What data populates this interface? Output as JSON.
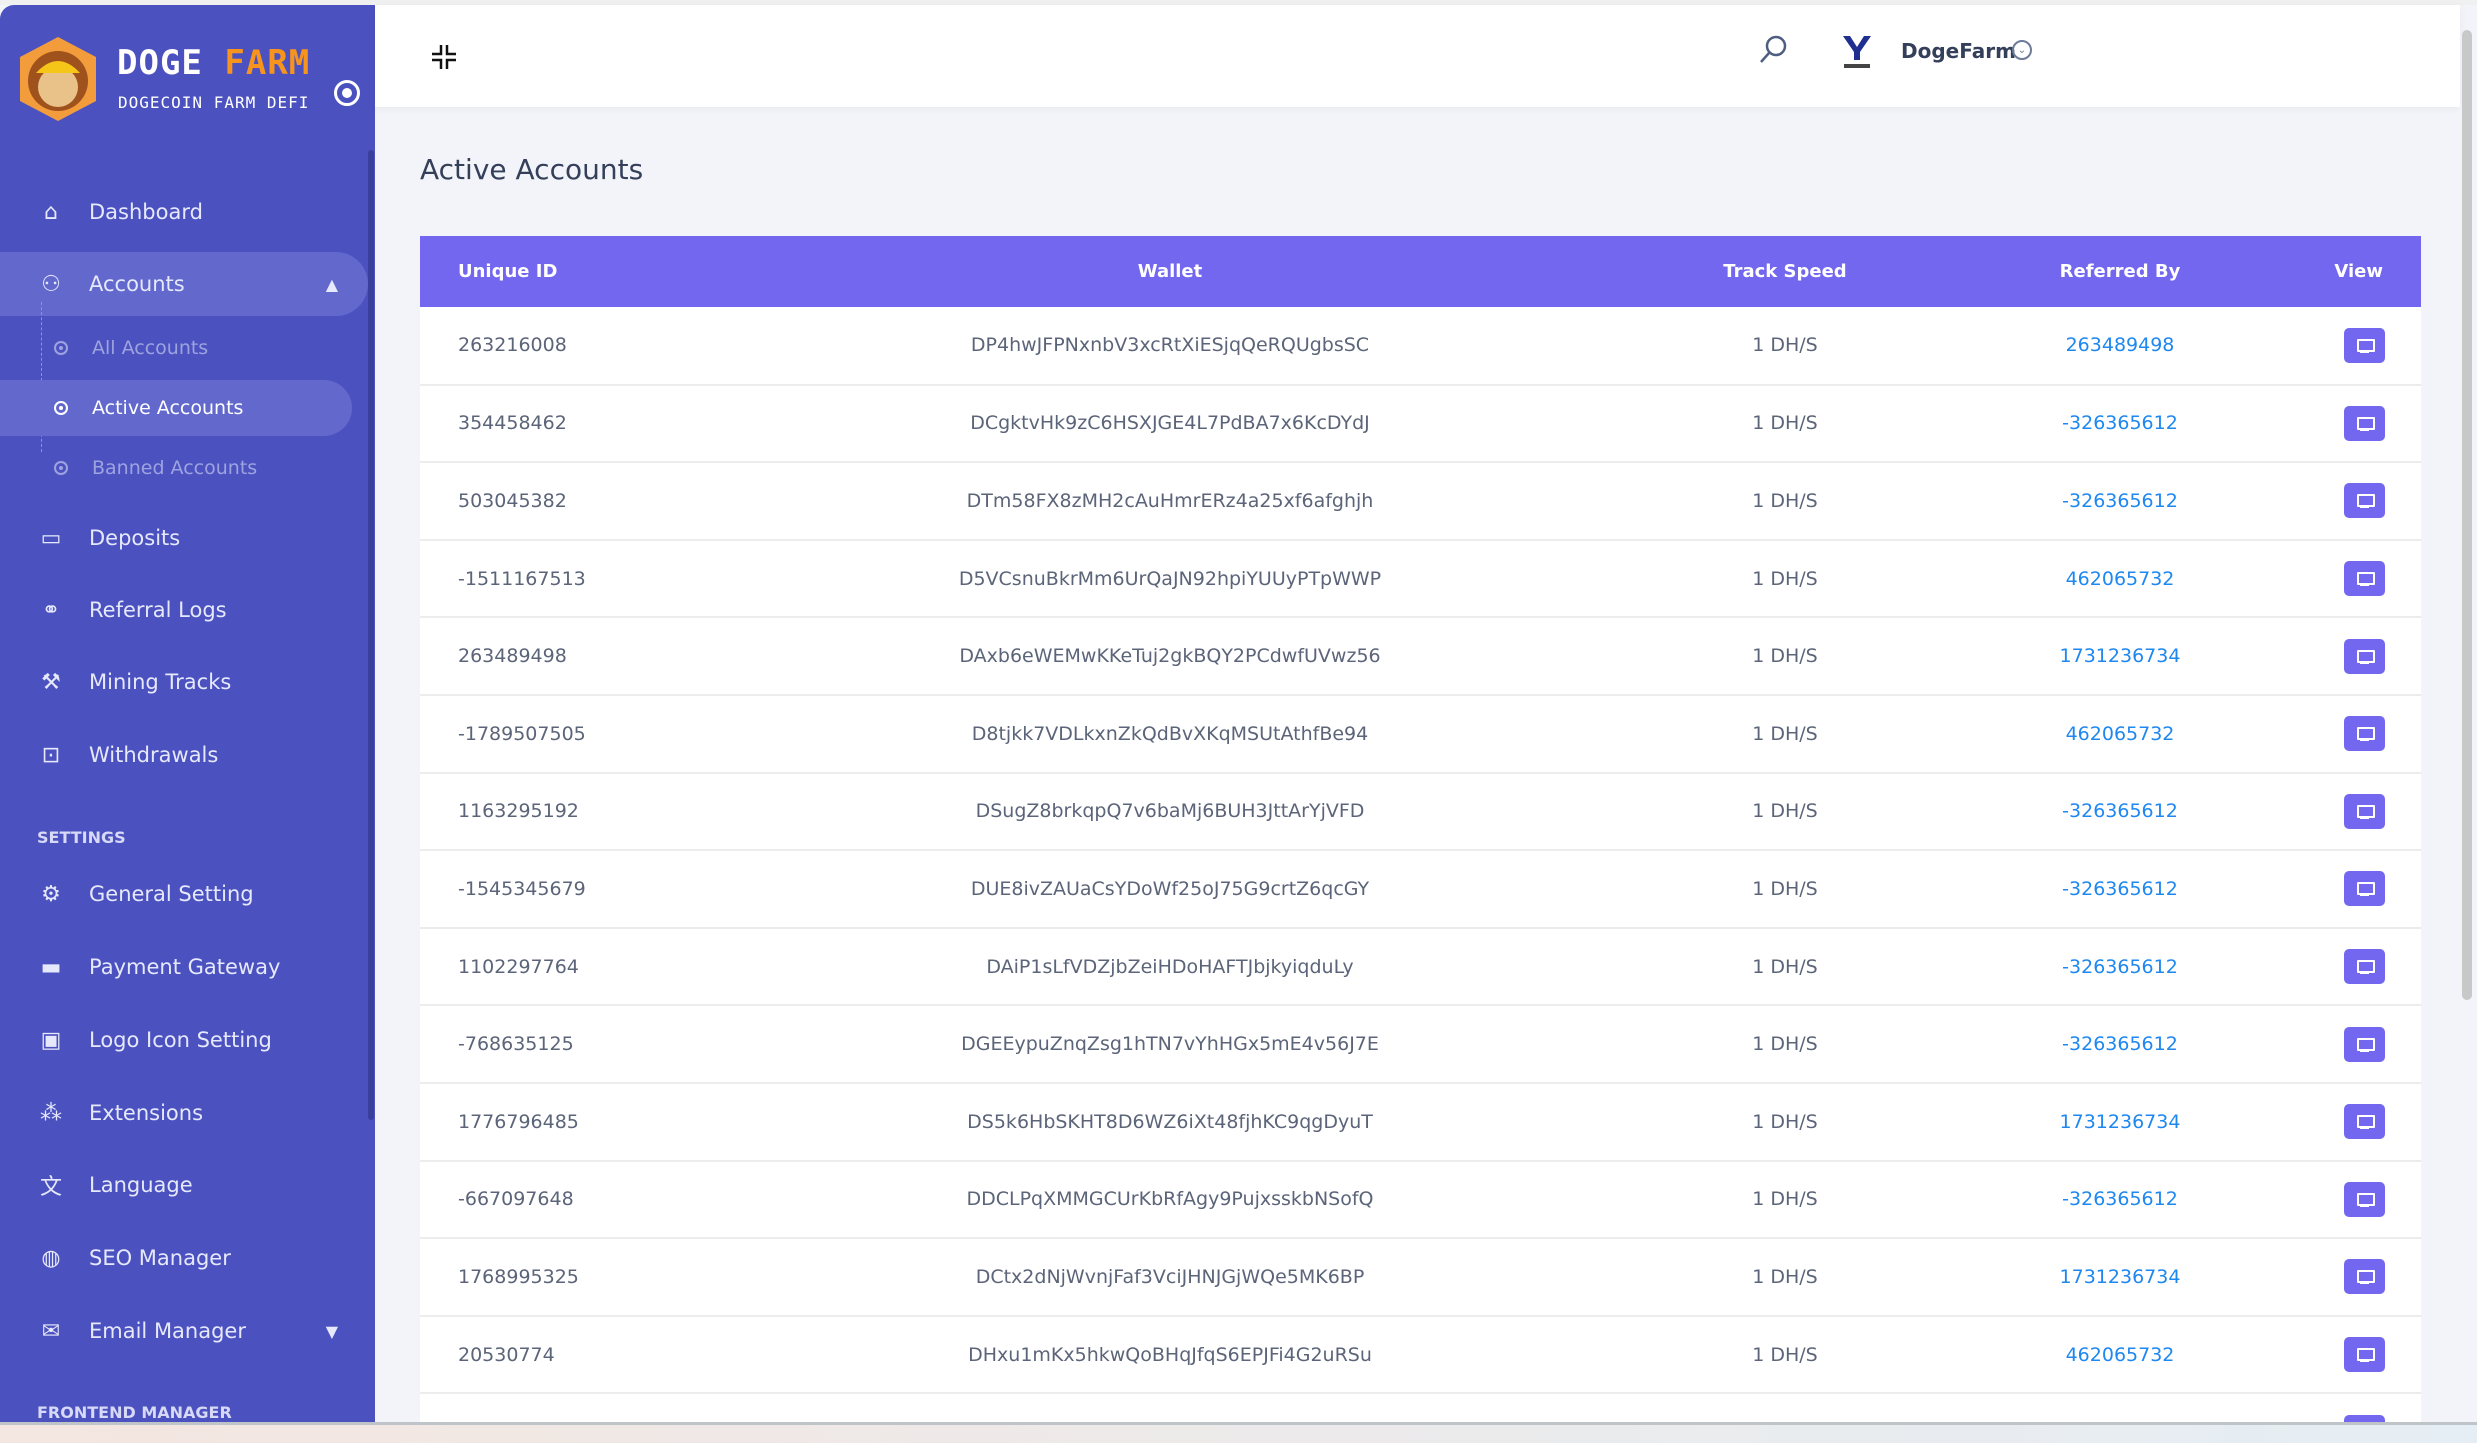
{
  "brand": {
    "name_part1": "DOGE",
    "name_part2": "FARM",
    "tagline": "DOGECOIN FARM DEFI"
  },
  "sidebar": {
    "items": [
      {
        "label": "Dashboard",
        "icon": "home-icon"
      },
      {
        "label": "Accounts",
        "icon": "users-icon"
      },
      {
        "label": "Deposits",
        "icon": "wallet-icon"
      },
      {
        "label": "Referral Logs",
        "icon": "referral-icon"
      },
      {
        "label": "Mining Tracks",
        "icon": "hammer-icon"
      },
      {
        "label": "Withdrawals",
        "icon": "money-icon"
      }
    ],
    "accounts_sub": [
      {
        "label": "All Accounts"
      },
      {
        "label": "Active Accounts"
      },
      {
        "label": "Banned Accounts"
      }
    ],
    "settings_heading": "SETTINGS",
    "settings_items": [
      {
        "label": "General Setting",
        "icon": "gear-icon"
      },
      {
        "label": "Payment Gateway",
        "icon": "credit-card-icon"
      },
      {
        "label": "Logo Icon Setting",
        "icon": "image-icon"
      },
      {
        "label": "Extensions",
        "icon": "puzzle-icon"
      },
      {
        "label": "Language",
        "icon": "language-icon"
      },
      {
        "label": "SEO Manager",
        "icon": "globe-icon"
      },
      {
        "label": "Email Manager",
        "icon": "envelope-icon"
      }
    ],
    "frontend_heading": "FRONTEND MANAGER"
  },
  "header": {
    "username": "DogeFarm"
  },
  "page": {
    "title": "Active Accounts"
  },
  "table": {
    "headers": [
      "Unique ID",
      "Wallet",
      "Track Speed",
      "Referred By",
      "View"
    ],
    "rows": [
      [
        "263216008",
        "DP4hwJFPNxnbV3xcRtXiESjqQeRQUgbsSC",
        "1 DH/S",
        "263489498"
      ],
      [
        "354458462",
        "DCgktvHk9zC6HSXJGE4L7PdBA7x6KcDYdJ",
        "1 DH/S",
        "-326365612"
      ],
      [
        "503045382",
        "DTm58FX8zMH2cAuHmrERz4a25xf6afghjh",
        "1 DH/S",
        "-326365612"
      ],
      [
        "-1511167513",
        "D5VCsnuBkrMm6UrQaJN92hpiYUUyPTpWWP",
        "1 DH/S",
        "462065732"
      ],
      [
        "263489498",
        "DAxb6eWEMwKKeTuj2gkBQY2PCdwfUVwz56",
        "1 DH/S",
        "1731236734"
      ],
      [
        "-1789507505",
        "D8tjkk7VDLkxnZkQdBvXKqMSUtAthfBe94",
        "1 DH/S",
        "462065732"
      ],
      [
        "1163295192",
        "DSugZ8brkqpQ7v6baMj6BUH3JttArYjVFD",
        "1 DH/S",
        "-326365612"
      ],
      [
        "-1545345679",
        "DUE8ivZAUaCsYDoWf25oJ75G9crtZ6qcGY",
        "1 DH/S",
        "-326365612"
      ],
      [
        "1102297764",
        "DAiP1sLfVDZjbZeiHDoHAFTJbjkyiqduLy",
        "1 DH/S",
        "-326365612"
      ],
      [
        "-768635125",
        "DGEEypuZnqZsg1hTN7vYhHGx5mE4v56J7E",
        "1 DH/S",
        "-326365612"
      ],
      [
        "1776796485",
        "DS5k6HbSKHT8D6WZ6iXt48fjhKC9qgDyuT",
        "1 DH/S",
        "1731236734"
      ],
      [
        "-667097648",
        "DDCLPqXMMGCUrKbRfAgy9PujxsskbNSofQ",
        "1 DH/S",
        "-326365612"
      ],
      [
        "1768995325",
        "DCtx2dNjWvnjFaf3VciJHNJGjWQe5MK6BP",
        "1 DH/S",
        "1731236734"
      ],
      [
        "20530774",
        "DHxu1mKx5hkwQoBHqJfqS6EPJFi4G2uRSu",
        "1 DH/S",
        "462065732"
      ],
      [
        "",
        "",
        "",
        ""
      ]
    ]
  },
  "colors": {
    "sidebar": "#4b52bf",
    "accent": "#7367f0",
    "link": "#1e87f0",
    "brand_orange": "#f7941d"
  }
}
